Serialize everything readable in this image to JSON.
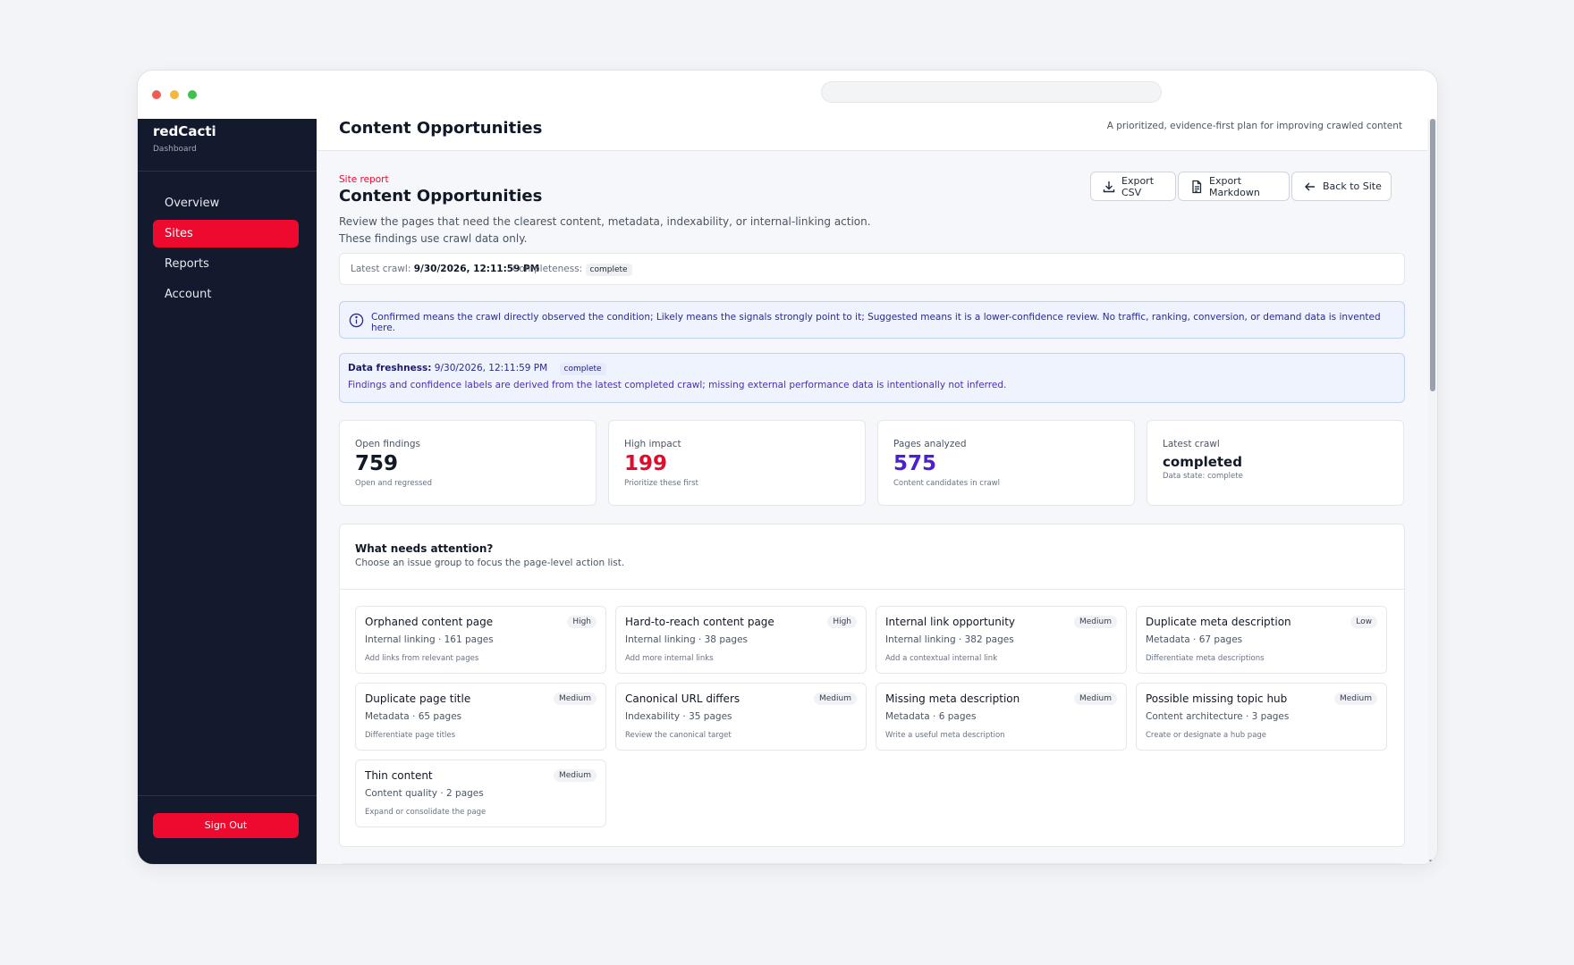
{
  "sidebar": {
    "brand": "redCacti",
    "brand_sub": "Dashboard",
    "items": [
      {
        "label": "Overview",
        "active": false
      },
      {
        "label": "Sites",
        "active": true
      },
      {
        "label": "Reports",
        "active": false
      },
      {
        "label": "Account",
        "active": false
      }
    ],
    "signout_label": "Sign Out"
  },
  "topbar": {
    "title": "Content Opportunities",
    "subtitle": "A prioritized, evidence-first plan for improving crawled content"
  },
  "header": {
    "eyebrow": "Site report",
    "title": "Content Opportunities",
    "description": "Review the pages that need the clearest content, metadata, indexability, or internal-linking action. These findings use crawl data only.",
    "buttons": {
      "export_csv": "Export CSV",
      "export_markdown": "Export Markdown",
      "back": "Back to Site"
    }
  },
  "crawl": {
    "latest_label": "Latest crawl:",
    "latest_value": "9/30/2026, 12:11:59 PM",
    "completeness_label": "Completeness:",
    "completeness_value": "complete"
  },
  "info": {
    "text": "Confirmed means the crawl directly observed the condition; Likely means the signals strongly point to it; Suggested means it is a lower-confidence review. No traffic, ranking, conversion, or demand data is invented here."
  },
  "freshness": {
    "label": "Data freshness:",
    "value": "9/30/2026, 12:11:59 PM",
    "status": "complete",
    "note": "Findings and confidence labels are derived from the latest completed crawl; missing external performance data is intentionally not inferred."
  },
  "stats": [
    {
      "label": "Open findings",
      "value": "759",
      "note": "Open and regressed",
      "color": "#111827"
    },
    {
      "label": "High impact",
      "value": "199",
      "note": "Prioritize these first",
      "color": "#e30b2c"
    },
    {
      "label": "Pages analyzed",
      "value": "575",
      "note": "Content candidates in crawl",
      "color": "#4c1fd1"
    },
    {
      "label": "Latest crawl",
      "value": "completed",
      "note": "Data state: complete",
      "color": "#111827"
    }
  ],
  "attention": {
    "title": "What needs attention?",
    "subtitle": "Choose an issue group to focus the page-level action list.",
    "cards": [
      {
        "title": "Orphaned content page",
        "badge": "High",
        "meta": "Internal linking · 161 pages",
        "action": "Add links from relevant pages"
      },
      {
        "title": "Hard-to-reach content page",
        "badge": "High",
        "meta": "Internal linking · 38 pages",
        "action": "Add more internal links"
      },
      {
        "title": "Internal link opportunity",
        "badge": "Medium",
        "meta": "Internal linking · 382 pages",
        "action": "Add a contextual internal link"
      },
      {
        "title": "Duplicate meta description",
        "badge": "Low",
        "meta": "Metadata · 67 pages",
        "action": "Differentiate meta descriptions"
      },
      {
        "title": "Duplicate page title",
        "badge": "Medium",
        "meta": "Metadata · 65 pages",
        "action": "Differentiate page titles"
      },
      {
        "title": "Canonical URL differs",
        "badge": "Medium",
        "meta": "Indexability · 35 pages",
        "action": "Review the canonical target"
      },
      {
        "title": "Missing meta description",
        "badge": "Medium",
        "meta": "Metadata · 6 pages",
        "action": "Write a useful meta description"
      },
      {
        "title": "Possible missing topic hub",
        "badge": "Medium",
        "meta": "Content architecture · 3 pages",
        "action": "Create or designate a hub page"
      },
      {
        "title": "Thin content",
        "badge": "Medium",
        "meta": "Content quality · 2 pages",
        "action": "Expand or consolidate the page"
      }
    ]
  }
}
